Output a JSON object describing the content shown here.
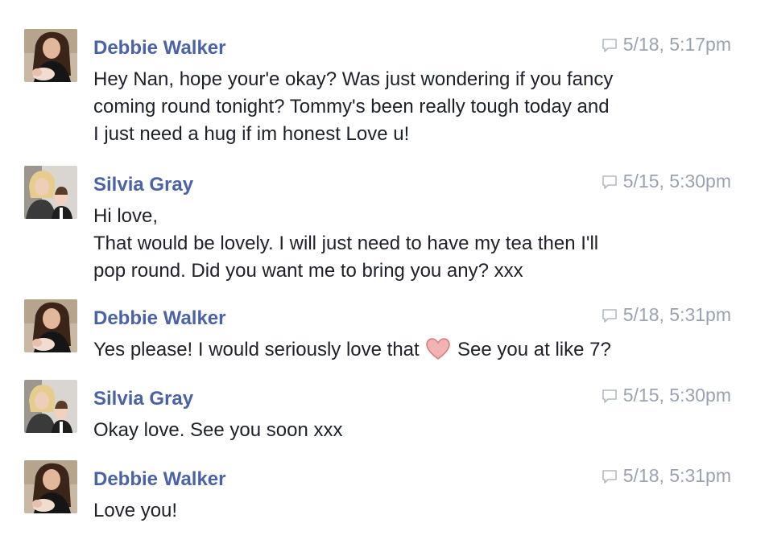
{
  "messages": [
    {
      "sender": "Debbie Walker",
      "avatar": "debbie-avatar",
      "timestamp": "5/18, 5:17pm",
      "lines": [
        "Hey Nan, hope your'e okay? Was just wondering if you fancy",
        "coming round tonight? Tommy's been really tough today and",
        "I just need a hug if im honest Love u!"
      ]
    },
    {
      "sender": "Silvia Gray",
      "avatar": "silvia-avatar",
      "timestamp": "5/15, 5:30pm",
      "lines": [
        "Hi love,",
        "That would be lovely. I will just need to have my tea then I'll",
        "pop round. Did you want me to bring you any? xxx"
      ]
    },
    {
      "sender": "Debbie Walker",
      "avatar": "debbie-avatar",
      "timestamp": "5/18, 5:31pm",
      "text_before_emoji": "Yes please! I would seriously love that",
      "emoji": "heart-icon",
      "text_after_emoji": "See you at like 7?"
    },
    {
      "sender": "Silvia Gray",
      "avatar": "silvia-avatar",
      "timestamp": "5/15, 5:30pm",
      "lines": [
        "Okay love. See you soon xxx"
      ]
    },
    {
      "sender": "Debbie Walker",
      "avatar": "debbie-avatar",
      "timestamp": "5/18, 5:31pm",
      "lines": [
        "Love you!"
      ]
    }
  ],
  "colors": {
    "sender_name": "#4a62a6",
    "timestamp": "#9aa2b1",
    "body_text": "#1d2129",
    "heart": "#e88c8c"
  }
}
